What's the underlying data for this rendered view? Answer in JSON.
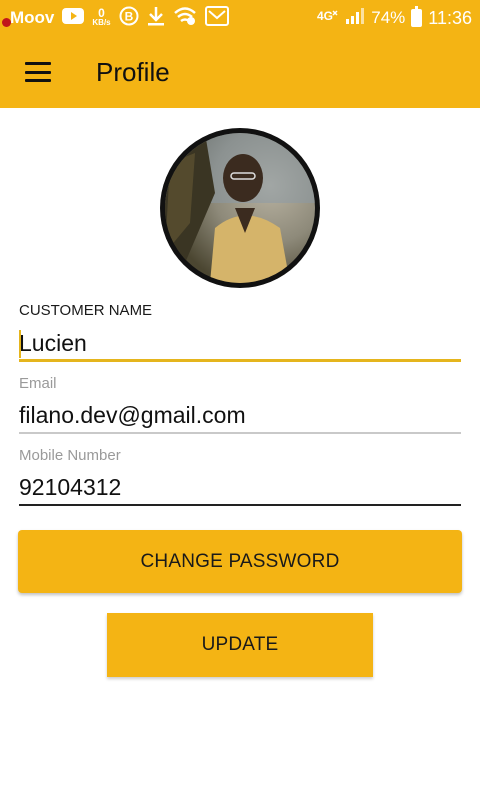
{
  "status_bar": {
    "carrier": "Moov",
    "net_speed_value": "0",
    "net_speed_unit": "KB/s",
    "battery": "74%",
    "time": "11:36",
    "icons": [
      "youtube-icon",
      "data-speed-icon",
      "b-icon",
      "download-icon",
      "wifi-icon",
      "gmail-icon",
      "4g-icon",
      "signal-icon",
      "battery-icon"
    ]
  },
  "app_bar": {
    "title": "Profile",
    "menu_icon": "hamburger-menu-icon"
  },
  "colors": {
    "accent": "#f4b414",
    "underline_active": "#e5b51d"
  },
  "form": {
    "customer_name": {
      "label": "CUSTOMER NAME",
      "value": "Lucien"
    },
    "email": {
      "label": "Email",
      "value": "filano.dev@gmail.com"
    },
    "mobile": {
      "label": "Mobile Number",
      "value": "92104312"
    }
  },
  "buttons": {
    "change_password": "CHANGE PASSWORD",
    "update": "UPDATE"
  }
}
